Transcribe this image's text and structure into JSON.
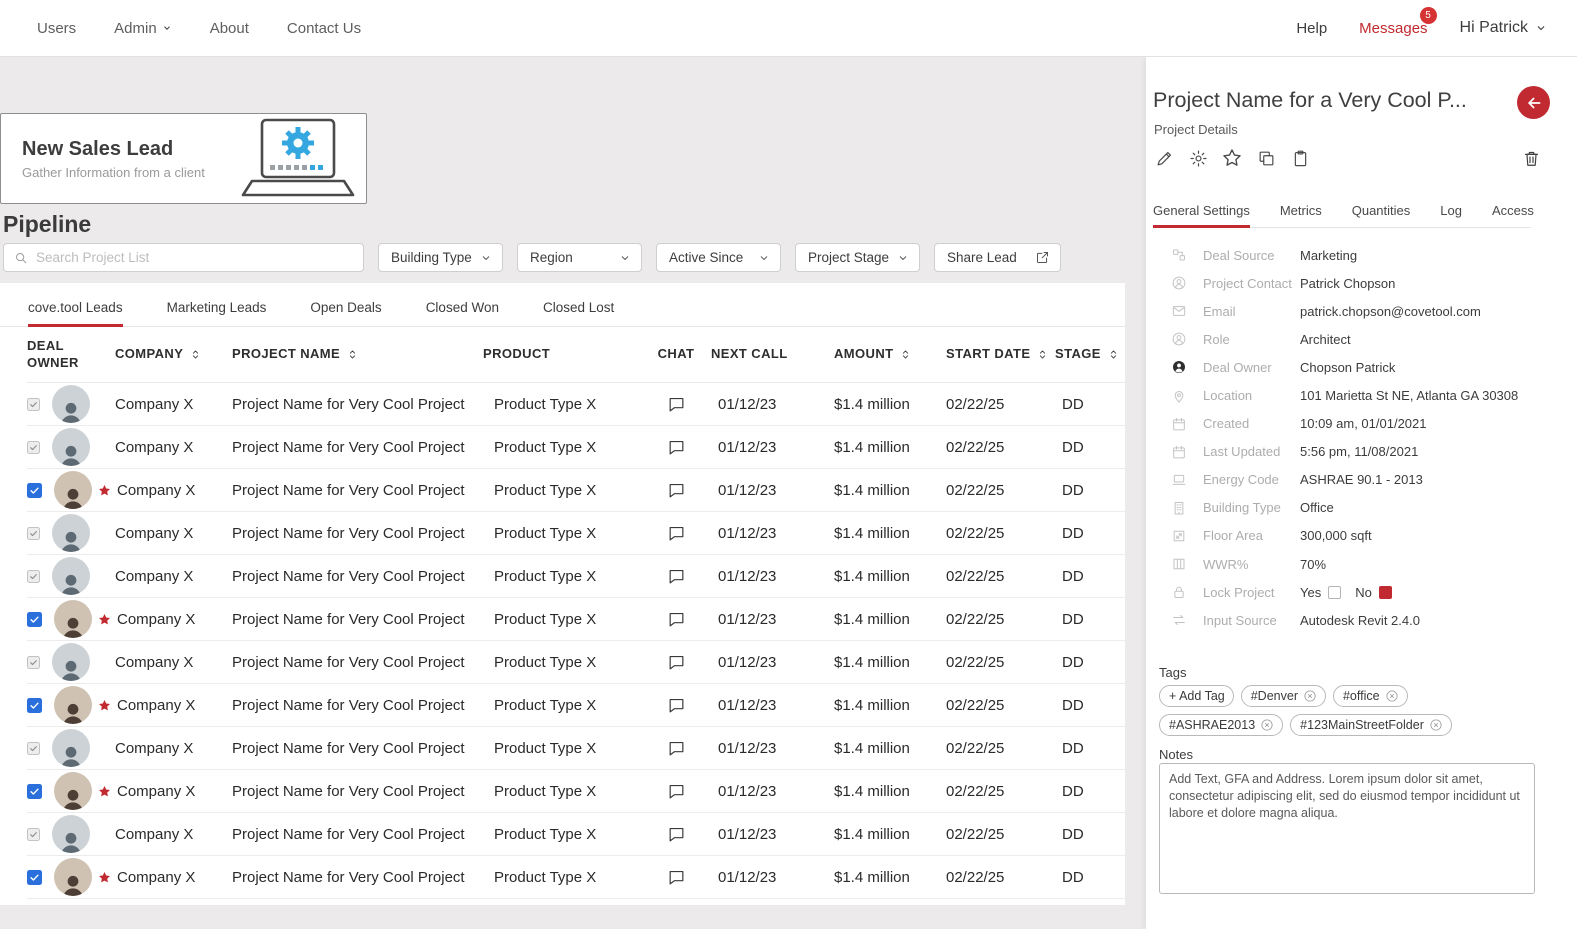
{
  "colors": {
    "accent_red": "#c02a30",
    "selection_blue": "#2a6fdb"
  },
  "nav": {
    "items": [
      {
        "label": "Users",
        "dropdown": false
      },
      {
        "label": "Admin",
        "dropdown": true
      },
      {
        "label": "About",
        "dropdown": false
      },
      {
        "label": "Contact Us",
        "dropdown": false
      }
    ],
    "help": "Help",
    "messages": {
      "label": "Messages",
      "badge": "5"
    },
    "user": {
      "label": "Hi Patrick"
    }
  },
  "lead_card": {
    "title": "New Sales Lead",
    "subtitle": "Gather Information from a client"
  },
  "pipeline": {
    "title": "Pipeline",
    "search_placeholder": "Search Project List",
    "filters": [
      "Building Type",
      "Region",
      "Active Since",
      "Project Stage"
    ],
    "share_label": "Share Lead",
    "tabs": [
      "cove.tool Leads",
      "Marketing Leads",
      "Open Deals",
      "Closed Won",
      "Closed Lost"
    ],
    "active_tab": 0
  },
  "table": {
    "columns": [
      {
        "label": "DEAL OWNER",
        "sortable": false,
        "two_line": true
      },
      {
        "label": "COMPANY",
        "sortable": true
      },
      {
        "label": "PROJECT NAME",
        "sortable": true
      },
      {
        "label": "PRODUCT",
        "sortable": false
      },
      {
        "label": "CHAT",
        "sortable": false,
        "align": "center"
      },
      {
        "label": "NEXT CALL",
        "sortable": false
      },
      {
        "label": "AMOUNT",
        "sortable": true
      },
      {
        "label": "START DATE",
        "sortable": true
      },
      {
        "label": "STAGE",
        "sortable": true
      }
    ],
    "rows": [
      {
        "selected": false,
        "starred": false,
        "company": "Company X",
        "project": "Project Name for Very Cool Project",
        "product": "Product Type X",
        "next_call": "01/12/23",
        "amount": "$1.4 million",
        "start_date": "02/22/25",
        "stage": "DD"
      },
      {
        "selected": false,
        "starred": false,
        "company": "Company X",
        "project": "Project Name for Very Cool Project",
        "product": "Product Type X",
        "next_call": "01/12/23",
        "amount": "$1.4 million",
        "start_date": "02/22/25",
        "stage": "DD"
      },
      {
        "selected": true,
        "starred": true,
        "company": "Company X",
        "project": "Project Name for Very Cool Project",
        "product": "Product Type X",
        "next_call": "01/12/23",
        "amount": "$1.4 million",
        "start_date": "02/22/25",
        "stage": "DD"
      },
      {
        "selected": false,
        "starred": false,
        "company": "Company X",
        "project": "Project Name for Very Cool Project",
        "product": "Product Type X",
        "next_call": "01/12/23",
        "amount": "$1.4 million",
        "start_date": "02/22/25",
        "stage": "DD"
      },
      {
        "selected": false,
        "starred": false,
        "company": "Company X",
        "project": "Project Name for Very Cool Project",
        "product": "Product Type X",
        "next_call": "01/12/23",
        "amount": "$1.4 million",
        "start_date": "02/22/25",
        "stage": "DD"
      },
      {
        "selected": true,
        "starred": true,
        "company": "Company X",
        "project": "Project Name for Very Cool Project",
        "product": "Product Type X",
        "next_call": "01/12/23",
        "amount": "$1.4 million",
        "start_date": "02/22/25",
        "stage": "DD"
      },
      {
        "selected": false,
        "starred": false,
        "company": "Company X",
        "project": "Project Name for Very Cool Project",
        "product": "Product Type X",
        "next_call": "01/12/23",
        "amount": "$1.4 million",
        "start_date": "02/22/25",
        "stage": "DD"
      },
      {
        "selected": true,
        "starred": true,
        "company": "Company X",
        "project": "Project Name for Very Cool Project",
        "product": "Product Type X",
        "next_call": "01/12/23",
        "amount": "$1.4 million",
        "start_date": "02/22/25",
        "stage": "DD"
      },
      {
        "selected": false,
        "starred": false,
        "company": "Company X",
        "project": "Project Name for Very Cool Project",
        "product": "Product Type X",
        "next_call": "01/12/23",
        "amount": "$1.4 million",
        "start_date": "02/22/25",
        "stage": "DD"
      },
      {
        "selected": true,
        "starred": true,
        "company": "Company X",
        "project": "Project Name for Very Cool Project",
        "product": "Product Type X",
        "next_call": "01/12/23",
        "amount": "$1.4 million",
        "start_date": "02/22/25",
        "stage": "DD"
      },
      {
        "selected": false,
        "starred": false,
        "company": "Company X",
        "project": "Project Name for Very Cool Project",
        "product": "Product Type X",
        "next_call": "01/12/23",
        "amount": "$1.4 million",
        "start_date": "02/22/25",
        "stage": "DD"
      },
      {
        "selected": true,
        "starred": true,
        "company": "Company X",
        "project": "Project Name for Very Cool Project",
        "product": "Product Type X",
        "next_call": "01/12/23",
        "amount": "$1.4 million",
        "start_date": "02/22/25",
        "stage": "DD"
      }
    ]
  },
  "panel": {
    "title": "Project Name for a Very Cool P...",
    "subtitle": "Project Details",
    "actions": [
      "edit",
      "settings",
      "favorite",
      "duplicate",
      "clipboard"
    ],
    "tabs": [
      "General Settings",
      "Metrics",
      "Quantities",
      "Log",
      "Access"
    ],
    "active_tab": 0,
    "fields": [
      {
        "icon": "deal-source",
        "label": "Deal Source",
        "value": "Marketing"
      },
      {
        "icon": "contact",
        "label": "Project Contact",
        "value": "Patrick Chopson"
      },
      {
        "icon": "email",
        "label": "Email",
        "value": "patrick.chopson@covetool.com"
      },
      {
        "icon": "role",
        "label": "Role",
        "value": "Architect"
      },
      {
        "icon": "owner",
        "label": "Deal Owner",
        "value": "Chopson Patrick",
        "dark": true
      },
      {
        "icon": "location",
        "label": "Location",
        "value": "101 Marietta St NE, Atlanta GA 30308"
      },
      {
        "icon": "created",
        "label": "Created",
        "value": "10:09 am, 01/01/2021"
      },
      {
        "icon": "last-updated",
        "label": "Last Updated",
        "value": "5:56 pm, 11/08/2021"
      },
      {
        "icon": "energy-code",
        "label": "Energy Code",
        "value": "ASHRAE 90.1 - 2013"
      },
      {
        "icon": "building-type",
        "label": "Building Type",
        "value": "Office"
      },
      {
        "icon": "floor-area",
        "label": "Floor Area",
        "value": "300,000 sqft"
      },
      {
        "icon": "wwr",
        "label": "WWR%",
        "value": "70%"
      },
      {
        "icon": "lock",
        "label": "Lock Project",
        "type": "lock",
        "yes": "Yes",
        "no": "No"
      },
      {
        "icon": "input-source",
        "label": "Input Source",
        "value": "Autodesk Revit 2.4.0"
      }
    ],
    "tags": {
      "label": "Tags",
      "add_label": "+ Add Tag",
      "items": [
        "#Denver",
        "#office",
        "#ASHRAE2013",
        "#123MainStreetFolder"
      ]
    },
    "notes": {
      "label": "Notes",
      "text": "Add Text, GFA and Address. Lorem ipsum dolor sit amet, consectetur adipiscing elit, sed do eiusmod tempor incididunt ut labore et dolore magna aliqua."
    }
  }
}
